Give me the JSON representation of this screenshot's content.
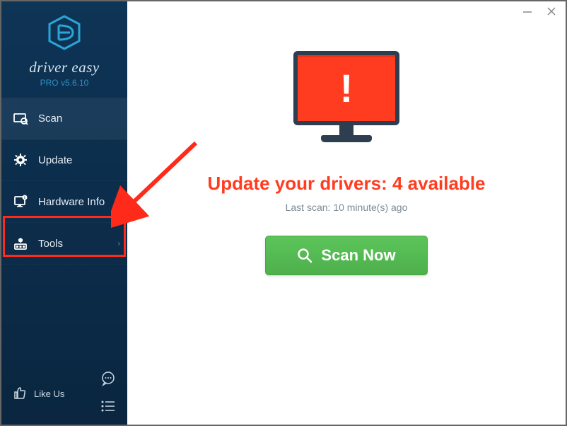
{
  "brand": "driver easy",
  "version": "PRO v5.6.10",
  "sidebar": {
    "items": [
      {
        "label": "Scan"
      },
      {
        "label": "Update"
      },
      {
        "label": "Hardware Info"
      },
      {
        "label": "Tools"
      }
    ],
    "like_label": "Like Us"
  },
  "main": {
    "headline": "Update your drivers: 4 available",
    "last_scan": "Last scan: 10 minute(s) ago",
    "scan_label": "Scan Now"
  }
}
